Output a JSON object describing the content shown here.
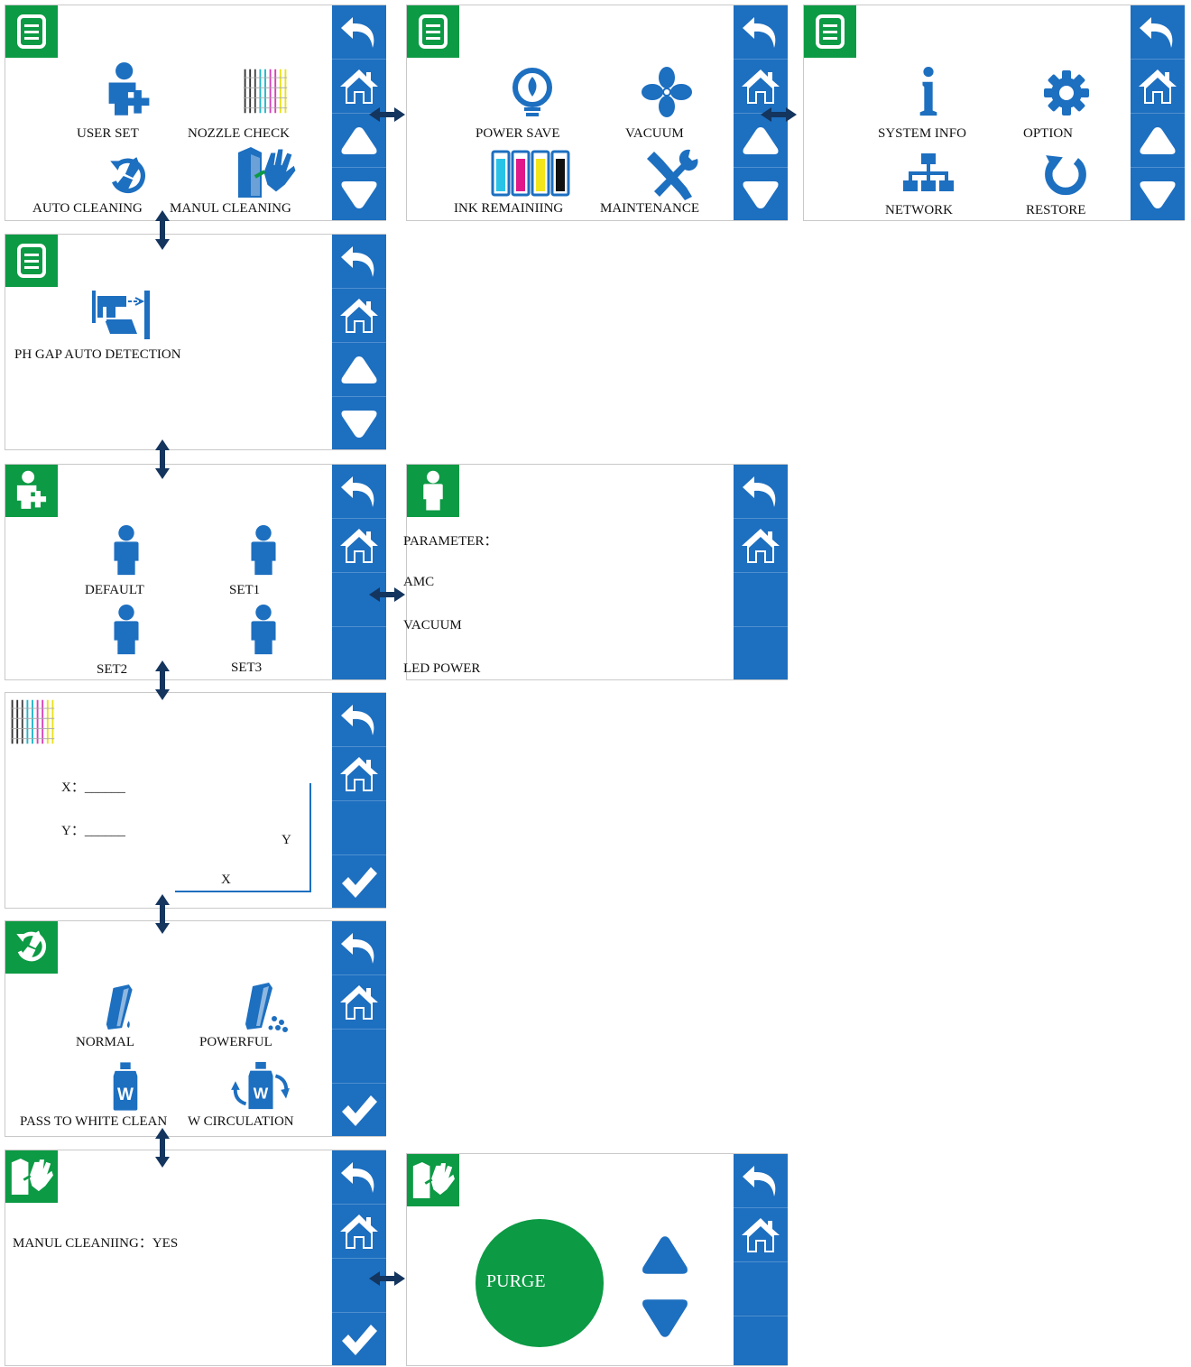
{
  "menu1": {
    "items": [
      "USER SET",
      "NOZZLE CHECK",
      "AUTO CLEANING",
      "MANUL CLEANING"
    ]
  },
  "menu2": {
    "items": [
      "POWER SAVE",
      "VACUUM",
      "INK REMAINIING",
      "MAINTENANCE"
    ]
  },
  "menu3": {
    "items": [
      "SYSTEM INFO",
      "OPTION",
      "NETWORK",
      "RESTORE"
    ]
  },
  "menu4": {
    "items": [
      "PH GAP AUTO DETECTION"
    ]
  },
  "user_set": {
    "items": [
      "DEFAULT",
      "SET1",
      "SET2",
      "SET3"
    ]
  },
  "user_params": {
    "items": [
      "PARAMETER：",
      "AMC",
      "VACUUM",
      "LED POWER"
    ]
  },
  "nozzle": {
    "x_label": "X：______",
    "y_label": "Y：______",
    "axis_x": "X",
    "axis_y": "Y"
  },
  "auto_clean": {
    "items": [
      "NORMAL",
      "POWERFUL",
      "PASS TO WHITE CLEAN",
      "W CIRCULATION"
    ]
  },
  "manual_clean": {
    "text": "MANUL CLEANIING：YES"
  },
  "purge": {
    "button": "PURGE"
  },
  "colors": {
    "sidebar": "#1d6fc0",
    "header": "#0c9a44",
    "icon": "#1d6fc0",
    "arrow": "#14355e"
  }
}
